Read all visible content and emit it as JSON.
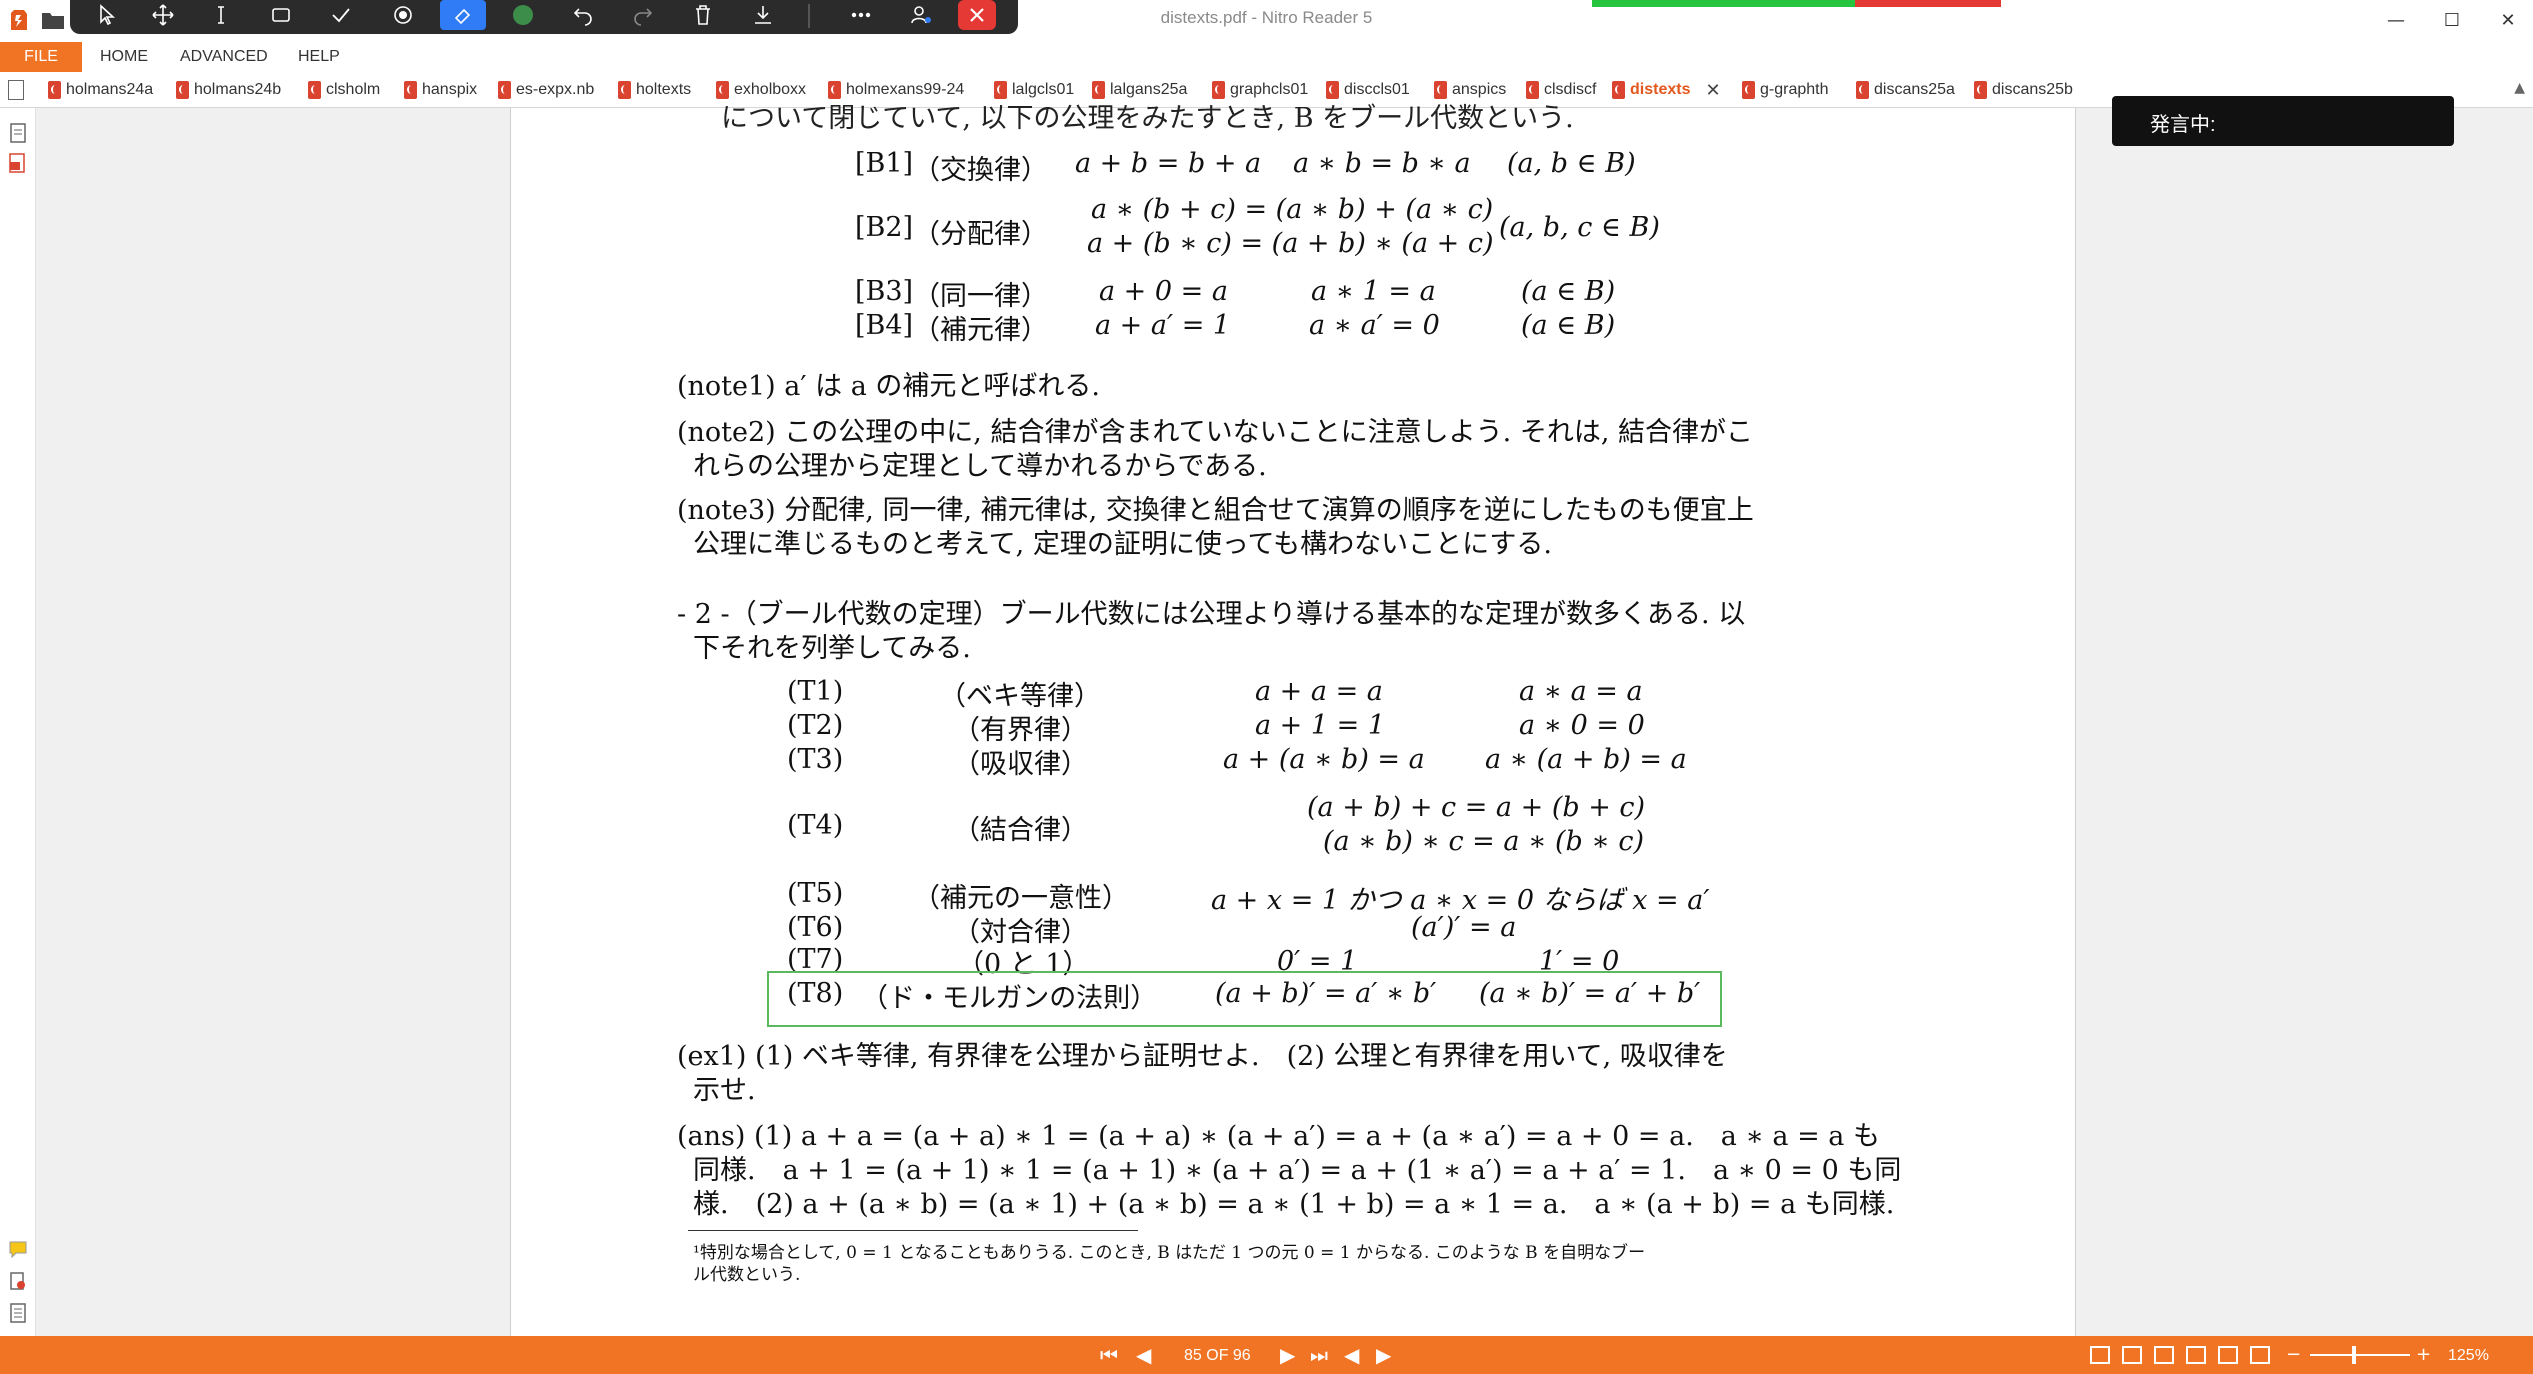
{
  "window": {
    "title": "distexts.pdf - Nitro Reader 5",
    "controls": {
      "minimize": "—",
      "maximize": "☐",
      "close": "✕"
    }
  },
  "toolbar": {
    "tools": [
      "select-arrow-icon",
      "pan-icon",
      "text-cursor-icon",
      "rectangle-icon",
      "checkmark-icon",
      "record-icon",
      "eraser-icon",
      "color-dot-icon",
      "undo-icon",
      "redo-icon",
      "trash-icon",
      "download-icon",
      "more-icon",
      "user-edit-icon",
      "close-icon"
    ],
    "accent": "#2f7cf6",
    "close_color": "#e53935"
  },
  "menu": {
    "file": "FILE",
    "items": [
      "HOME",
      "ADVANCED",
      "HELP"
    ]
  },
  "tabs": [
    {
      "label": "holmans24a"
    },
    {
      "label": "holmans24b"
    },
    {
      "label": "clsholm"
    },
    {
      "label": "hanspix"
    },
    {
      "label": "es-expx.nb"
    },
    {
      "label": "holtexts"
    },
    {
      "label": "exholboxx"
    },
    {
      "label": "holmexans99-24"
    },
    {
      "label": "lalgcls01"
    },
    {
      "label": "lalgans25a"
    },
    {
      "label": "graphcls01"
    },
    {
      "label": "disccls01"
    },
    {
      "label": "anspics"
    },
    {
      "label": "clsdiscf"
    },
    {
      "label": "distexts",
      "active": true
    },
    {
      "label": "g-graphth"
    },
    {
      "label": "discans25a"
    },
    {
      "label": "discans25b"
    }
  ],
  "speaking": {
    "label": "発言中:"
  },
  "doc": {
    "top_line": "について閉じていて, 以下の公理をみたすとき, B をブール代数という.",
    "axioms": [
      {
        "id": "[B1]",
        "name": "（交換律）",
        "f1": "a + b = b + a",
        "f2": "a ∗ b = b ∗ a",
        "cond": "(a, b ∈ B)"
      },
      {
        "id": "[B2]",
        "name": "（分配律）",
        "f1": "a ∗ (b + c) = (a ∗ b) + (a ∗ c)",
        "f2": "a + (b ∗ c) = (a + b) ∗ (a + c)",
        "cond": "(a, b, c ∈ B)"
      },
      {
        "id": "[B3]",
        "name": "（同一律）",
        "f1": "a + 0 = a",
        "f2": "a ∗ 1 = a",
        "cond": "(a ∈ B)"
      },
      {
        "id": "[B4]",
        "name": "（補元律）",
        "f1": "a + a′ = 1",
        "f2": "a ∗ a′ = 0",
        "cond": "(a ∈ B)"
      }
    ],
    "note1": "(note1) a′ は a の補元と呼ばれる.",
    "note2_l1": "(note2) この公理の中に, 結合律が含まれていないことに注意しよう. それは, 結合律がこ",
    "note2_l2": "れらの公理から定理として導かれるからである.",
    "note3_l1": "(note3) 分配律, 同一律, 補元律は, 交換律と組合せて演算の順序を逆にしたものも便宜上",
    "note3_l2": "公理に準じるものと考えて, 定理の証明に使っても構わないことにする.",
    "sec2_l1": "- 2 -（ブール代数の定理）ブール代数には公理より導ける基本的な定理が数多くある. 以",
    "sec2_l2": "下それを列挙してみる.",
    "theorems": [
      {
        "id": "(T1)",
        "name": "（ベキ等律）",
        "f1": "a + a = a",
        "f2": "a ∗ a = a"
      },
      {
        "id": "(T2)",
        "name": "（有界律）",
        "f1": "a + 1 = 1",
        "f2": "a ∗ 0 = 0"
      },
      {
        "id": "(T3)",
        "name": "（吸収律）",
        "f1": "a + (a ∗ b) = a",
        "f2": "a ∗ (a + b) = a"
      },
      {
        "id": "(T4)",
        "name": "（結合律）",
        "f1": "(a + b) + c = a + (b + c)",
        "f2": "(a ∗ b) ∗ c = a ∗ (b ∗ c)"
      },
      {
        "id": "(T5)",
        "name": "（補元の一意性）",
        "f1": "a + x = 1 かつ a ∗ x = 0 ならば x = a′",
        "f2": ""
      },
      {
        "id": "(T6)",
        "name": "（対合律）",
        "f1": "(a′)′ = a",
        "f2": ""
      },
      {
        "id": "(T7)",
        "name": "（0 と 1）",
        "f1": "0′ = 1",
        "f2": "1′ = 0"
      },
      {
        "id": "(T8)",
        "name": "（ド・モルガンの法則）",
        "f1": "(a + b)′ = a′ ∗ b′",
        "f2": "(a ∗ b)′ = a′ + b′"
      }
    ],
    "ex1_l1": "(ex1) (1) ベキ等律, 有界律を公理から証明せよ.　(2) 公理と有界律を用いて, 吸収律を",
    "ex1_l2": "示せ.",
    "ans_l1": "(ans) (1) a + a = (a + a) ∗ 1 = (a + a) ∗ (a + a′) = a + (a ∗ a′) = a + 0 = a.　a ∗ a = a も",
    "ans_l2": "同様.　a + 1 = (a + 1) ∗ 1 = (a + 1) ∗ (a + a′) = a + (1 ∗ a′) = a + a′ = 1.　a ∗ 0 = 0 も同",
    "ans_l3": "様.　(2) a + (a ∗ b) = (a ∗ 1) + (a ∗ b) = a ∗ (1 + b) = a ∗ 1 = a.　a ∗ (a + b) = a も同様.",
    "footnote_l1": "¹特別な場合として, 0 = 1 となることもありうる. このとき, B はただ 1 つの元 0 = 1 からなる. このような B を自明なブー",
    "footnote_l2": "ル代数という."
  },
  "status": {
    "page_count": "85 OF 96",
    "zoom": "125%",
    "zoom_minus": "−",
    "zoom_plus": "+",
    "bar_color": "#f07424"
  }
}
